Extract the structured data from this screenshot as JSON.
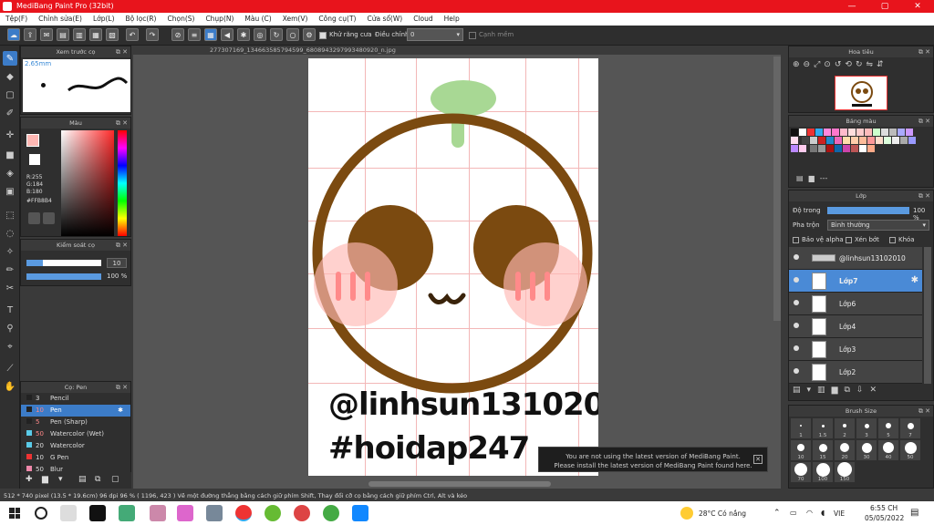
{
  "titlebar": {
    "title": "MediBang Paint Pro (32bit)",
    "min": "—",
    "max": "▢",
    "close": "✕"
  },
  "menu": [
    "Tệp(F)",
    "Chỉnh sửa(E)",
    "Lớp(L)",
    "Bộ lọc(R)",
    "Chọn(S)",
    "Chụp(N)",
    "Màu (C)",
    "Xem(V)",
    "Công cụ(T)",
    "Cửa sổ(W)",
    "Cloud",
    "Help"
  ],
  "toolbar": {
    "antialias_label": "Khử răng cưa",
    "adjust_label": "Điều chỉnh",
    "adjust_value": "0",
    "snap_label": "Cạnh mềm"
  },
  "preview_panel": {
    "title": "Xem trước cọ",
    "size": "2.65mm"
  },
  "color_panel": {
    "title": "Màu",
    "r": "R:255",
    "g": "G:184",
    "b": "B:180",
    "hex": "#FFB8B4"
  },
  "brush_ctrl": {
    "title": "Kiểm soát cọ",
    "size": "10",
    "opacity": "100 %"
  },
  "brush_list": {
    "title": "Cọ: Pen",
    "items": [
      {
        "size": "3",
        "name": "Pencil"
      },
      {
        "size": "10",
        "name": "Pen",
        "selected": true
      },
      {
        "size": "5",
        "name": "Pen (Sharp)"
      },
      {
        "size": "50",
        "name": "Watercolor (Wet)"
      },
      {
        "size": "20",
        "name": "Watercolor"
      },
      {
        "size": "10",
        "name": "G Pen"
      },
      {
        "size": "50",
        "name": "Blur"
      }
    ]
  },
  "document": {
    "tab": "277307169_134663585794599_6808943297993480920_n.jpg",
    "text1": "@linhsun13102010",
    "text2": "#hoidap247"
  },
  "navigator": {
    "title": "Hoa tiêu"
  },
  "palette": {
    "title": "Bảng màu",
    "dash": "---"
  },
  "layers": {
    "title": "Lớp",
    "opacity_label": "Độ trong",
    "opacity_value": "100 %",
    "blend_label": "Pha trộn",
    "blend_value": "Bình thường",
    "alpha_lock": "Bảo vệ alpha",
    "clip": "Xén bớt",
    "lock": "Khóa",
    "items": [
      "@linhsun13102010",
      "Lớp7",
      "Lớp6",
      "Lớp4",
      "Lớp3",
      "Lớp2"
    ]
  },
  "brush_size": {
    "title": "Brush Size",
    "labels": [
      "1",
      "1.5",
      "2",
      "3",
      "5",
      "7",
      "10",
      "15",
      "20",
      "30",
      "40",
      "50",
      "70",
      "100",
      "150"
    ]
  },
  "notice": {
    "line1": "You are not using the latest version of MediBang Paint.",
    "line2": "Please install the latest version of MediBang Paint found here."
  },
  "status": {
    "text": "512 * 740 pixel  (13.5 * 19.6cm)  96 dpi  96 %  ( 1196, 423 )  Vẽ một đường thẳng bằng cách giữ phím Shift, Thay đổi cỡ cọ bằng cách giữ phím Ctrl, Alt và kéo"
  },
  "taskbar": {
    "weather": "28°C  Có nắng",
    "lang": "VIE",
    "time": "6:55 CH",
    "date": "05/05/2022"
  }
}
